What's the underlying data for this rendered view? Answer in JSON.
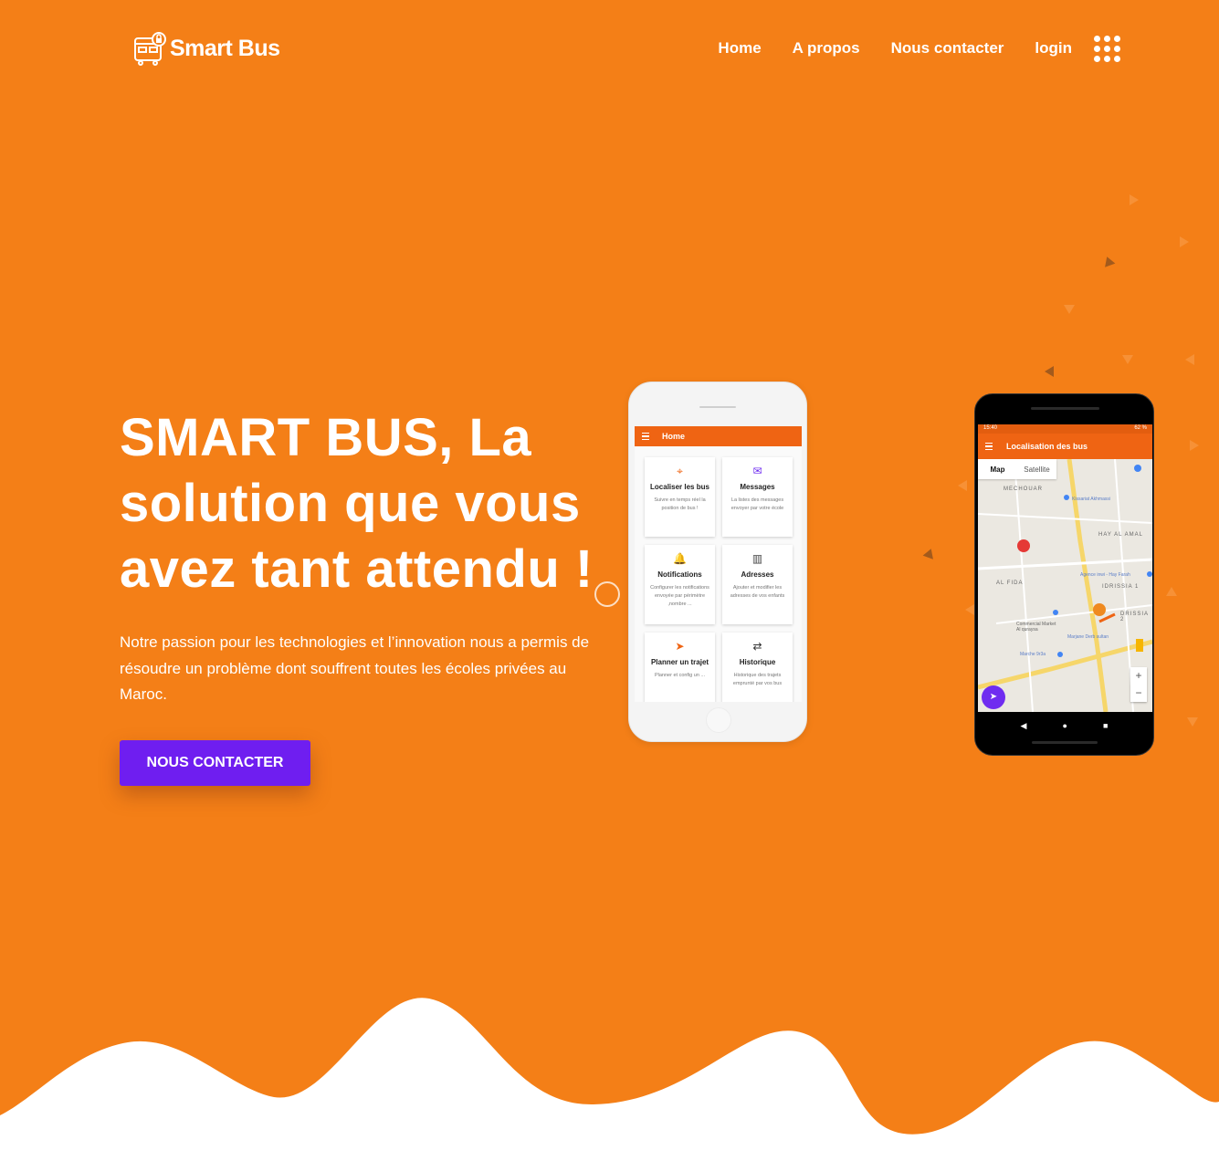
{
  "brand": {
    "name": "Smart Bus",
    "accent": "#f47f17",
    "cta_color": "#6f1ef0"
  },
  "nav": {
    "home": "Home",
    "about": "A propos",
    "contact": "Nous contacter",
    "login": "login",
    "apps_icon": "grid-icon"
  },
  "hero": {
    "title": "SMART BUS, La solution que vous avez tant attendu !",
    "text": "Notre passion pour les technologies et l’innovation nous a permis de résoudre un problème dont souffrent toutes les écoles privées au Maroc.",
    "cta": "NOUS CONTACTER"
  },
  "phone1": {
    "bar_title": "Home",
    "cards": [
      {
        "icon": "crosshair-icon",
        "glyph": "⌖",
        "color": "#ef6413",
        "title": "Localiser les bus",
        "desc": "Suivre en temps réel la position de bus !"
      },
      {
        "icon": "mail-icon",
        "glyph": "✉",
        "color": "#6f2cf0",
        "title": "Messages",
        "desc": "La listes des messages envoyer par votre école"
      },
      {
        "icon": "bell-icon",
        "glyph": "🔔",
        "color": "#e53935",
        "title": "Notifications",
        "desc": "Configurer les notifications envoyée par périmètre ,nombre ..."
      },
      {
        "icon": "map-icon",
        "glyph": "▥",
        "color": "#444444",
        "title": "Adresses",
        "desc": "Ajouter et modifier les adresses de vos enfants"
      },
      {
        "icon": "navigation-icon",
        "glyph": "➤",
        "color": "#ef6413",
        "title": "Planner un trajet",
        "desc": "Planner et config un ..."
      },
      {
        "icon": "swap-icon",
        "glyph": "⇄",
        "color": "#333333",
        "title": "Historique",
        "desc": "Historique des trajets emprunté par vos bus"
      }
    ]
  },
  "phone2": {
    "status_time": "15:40",
    "status_battery": "62 %",
    "bar_title": "Localisation des bus",
    "map_tab": "Map",
    "satellite_tab": "Satellite",
    "labels": [
      "MECHOUAR",
      "HAY AL AMAL",
      "AL FIDA",
      "IDRISSIA 1",
      "DRISSIA 2",
      "Kissariat Akhmassi",
      "Agence inwi - Hay Farah",
      "Commercial Market Al quraysa",
      "Marjane Derb sultan",
      "Marche 9r3a"
    ],
    "zoom_in": "+",
    "zoom_out": "−",
    "nav_back": "◀",
    "nav_home": "●",
    "nav_recent": "■"
  }
}
